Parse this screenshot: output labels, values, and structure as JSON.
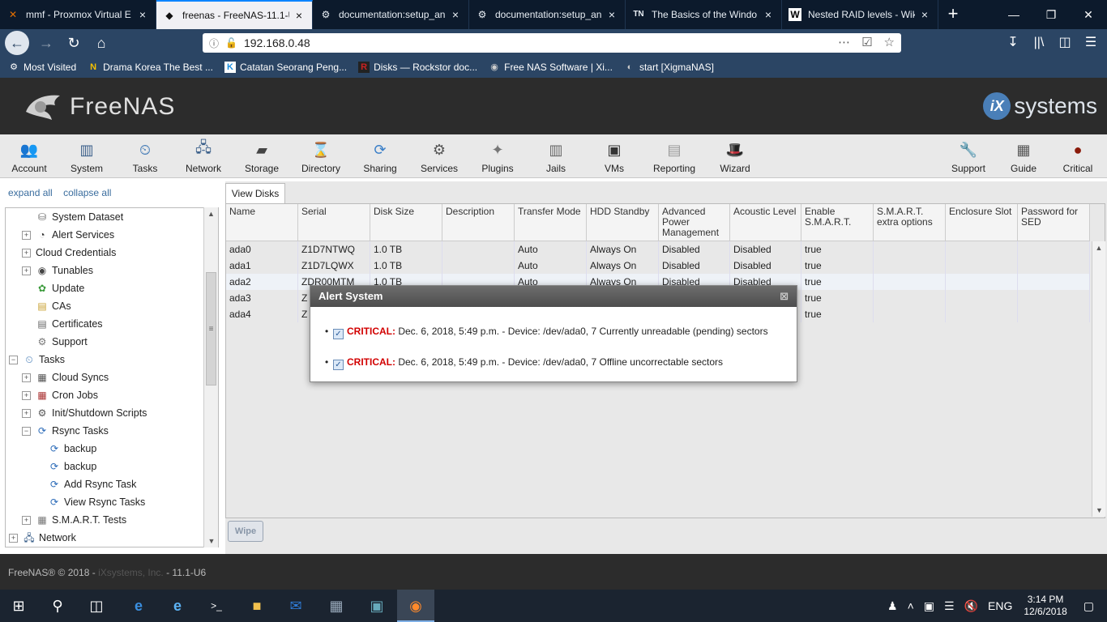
{
  "browser": {
    "tabs": [
      {
        "icon": "proxmox-icon",
        "label": "mmf - Proxmox Virtual E",
        "active": false
      },
      {
        "icon": "freenas-icon",
        "label": "freenas - FreeNAS-11.1-U",
        "active": true
      },
      {
        "icon": "gear-icon",
        "label": "documentation:setup_an",
        "active": false
      },
      {
        "icon": "gear-icon",
        "label": "documentation:setup_an",
        "active": false
      },
      {
        "icon": "tn-icon",
        "label": "The Basics of the Windo",
        "active": false
      },
      {
        "icon": "wikipedia-icon",
        "label": "Nested RAID levels - Wiki",
        "active": false
      }
    ],
    "tn_glyph": "TN",
    "wiki_glyph": "W",
    "url": "192.168.0.48",
    "bookmarks": [
      {
        "icon": "gear-icon",
        "label": "Most Visited"
      },
      {
        "icon": "drama-icon",
        "label": "Drama Korea The Best ..."
      },
      {
        "icon": "k-icon",
        "label": "Catatan Seorang Peng..."
      },
      {
        "icon": "rockstor-icon",
        "label": "Disks — Rockstor doc..."
      },
      {
        "icon": "globe-icon",
        "label": "Free NAS Software | Xi..."
      },
      {
        "icon": "xigma-icon",
        "label": "start [XigmaNAS]"
      }
    ],
    "bookmark_glyphs": {
      "drama": "N",
      "k": "K",
      "rockstor": "R"
    }
  },
  "header": {
    "logo_text": "FreeNAS",
    "vendor_badge": "iX",
    "vendor_text": "systems"
  },
  "toolbar": {
    "left": [
      {
        "id": "account",
        "label": "Account"
      },
      {
        "id": "system",
        "label": "System"
      },
      {
        "id": "tasks",
        "label": "Tasks"
      },
      {
        "id": "network",
        "label": "Network"
      },
      {
        "id": "storage",
        "label": "Storage"
      },
      {
        "id": "directory",
        "label": "Directory"
      },
      {
        "id": "sharing",
        "label": "Sharing"
      },
      {
        "id": "services",
        "label": "Services"
      },
      {
        "id": "plugins",
        "label": "Plugins"
      },
      {
        "id": "jails",
        "label": "Jails"
      },
      {
        "id": "vms",
        "label": "VMs"
      },
      {
        "id": "reporting",
        "label": "Reporting"
      },
      {
        "id": "wizard",
        "label": "Wizard"
      }
    ],
    "right": [
      {
        "id": "support",
        "label": "Support"
      },
      {
        "id": "guide",
        "label": "Guide"
      },
      {
        "id": "critical",
        "label": "Critical"
      }
    ]
  },
  "sidebar": {
    "expand_all": "expand all",
    "collapse_all": "collapse all",
    "tree": [
      {
        "label": "System Dataset",
        "level": 2,
        "toggle": "",
        "icon": "dataset-icon"
      },
      {
        "label": "Alert Services",
        "level": 2,
        "toggle": "+",
        "icon": "alert-icon"
      },
      {
        "label": "Cloud Credentials",
        "level": 2,
        "toggle": "+",
        "icon": ""
      },
      {
        "label": "Tunables",
        "level": 2,
        "toggle": "+",
        "icon": "tunables-icon"
      },
      {
        "label": "Update",
        "level": 2,
        "toggle": "",
        "icon": "update-icon"
      },
      {
        "label": "CAs",
        "level": 2,
        "toggle": "",
        "icon": "ca-icon"
      },
      {
        "label": "Certificates",
        "level": 2,
        "toggle": "",
        "icon": "certificate-icon"
      },
      {
        "label": "Support",
        "level": 2,
        "toggle": "",
        "icon": "support-icon"
      },
      {
        "label": "Tasks",
        "level": 1,
        "toggle": "−",
        "icon": "tasks-icon"
      },
      {
        "label": "Cloud Syncs",
        "level": 2,
        "toggle": "+",
        "icon": "cloud-icon"
      },
      {
        "label": "Cron Jobs",
        "level": 2,
        "toggle": "+",
        "icon": "cron-icon"
      },
      {
        "label": "Init/Shutdown Scripts",
        "level": 2,
        "toggle": "+",
        "icon": "script-icon"
      },
      {
        "label": "Rsync Tasks",
        "level": 2,
        "toggle": "−",
        "icon": "rsync-icon"
      },
      {
        "label": "backup",
        "level": 3,
        "toggle": "",
        "icon": "rsync-icon"
      },
      {
        "label": "backup",
        "level": 3,
        "toggle": "",
        "icon": "rsync-icon"
      },
      {
        "label": "Add Rsync Task",
        "level": 3,
        "toggle": "",
        "icon": "rsync-add-icon"
      },
      {
        "label": "View Rsync Tasks",
        "level": 3,
        "toggle": "",
        "icon": "rsync-view-icon"
      },
      {
        "label": "S.M.A.R.T. Tests",
        "level": 2,
        "toggle": "+",
        "icon": "smart-icon"
      },
      {
        "label": "Network",
        "level": 1,
        "toggle": "+",
        "icon": "network-icon"
      }
    ]
  },
  "main": {
    "tab_label": "View Disks",
    "columns": [
      "Name",
      "Serial",
      "Disk Size",
      "Description",
      "Transfer Mode",
      "HDD Standby",
      "Advanced Power Management",
      "Acoustic Level",
      "Enable S.M.A.R.T.",
      "S.M.A.R.T. extra options",
      "Enclosure Slot",
      "Password for SED"
    ],
    "rows": [
      [
        "ada0",
        "Z1D7NTWQ",
        "1.0 TB",
        "",
        "Auto",
        "Always On",
        "Disabled",
        "Disabled",
        "true",
        "",
        "",
        ""
      ],
      [
        "ada1",
        "Z1D7LQWX",
        "1.0 TB",
        "",
        "Auto",
        "Always On",
        "Disabled",
        "Disabled",
        "true",
        "",
        "",
        ""
      ],
      [
        "ada2",
        "ZDR00MTM",
        "1.0 TB",
        "",
        "Auto",
        "Always On",
        "Disabled",
        "Disabled",
        "true",
        "",
        "",
        ""
      ],
      [
        "ada3",
        "Z",
        "",
        "",
        "",
        "",
        "",
        "",
        "true",
        "",
        "",
        ""
      ],
      [
        "ada4",
        "Z",
        "",
        "",
        "",
        "",
        "",
        "",
        "true",
        "",
        "",
        ""
      ]
    ],
    "wipe_label": "Wipe"
  },
  "alert": {
    "title": "Alert System",
    "close_glyph": "⊠",
    "items": [
      {
        "level": "CRITICAL:",
        "text": "Dec. 6, 2018, 5:49 p.m. - Device: /dev/ada0, 7 Currently unreadable (pending) sectors"
      },
      {
        "level": "CRITICAL:",
        "text": "Dec. 6, 2018, 5:49 p.m. - Device: /dev/ada0, 7 Offline uncorrectable sectors"
      }
    ]
  },
  "footer": {
    "copyright": "FreeNAS® © 2018 - ",
    "vendor": "iXsystems, Inc.",
    "version": " - 11.1-U6"
  },
  "taskbar": {
    "lang": "ENG",
    "time": "3:14 PM",
    "date": "12/6/2018"
  },
  "colors": {
    "critical": "#d20000",
    "accent": "#3a6d9e"
  }
}
